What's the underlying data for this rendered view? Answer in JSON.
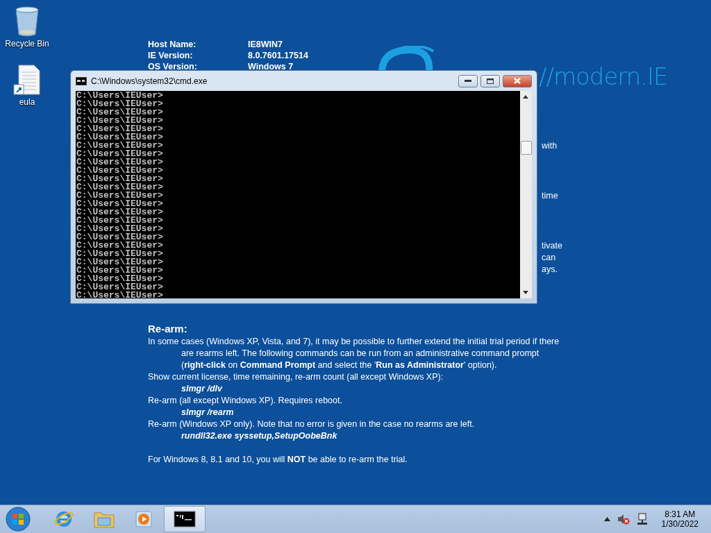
{
  "desktop_icons": [
    {
      "label": "Recycle Bin",
      "kind": "recycle"
    },
    {
      "label": "eula",
      "kind": "document"
    }
  ],
  "wallpaper": {
    "info": [
      {
        "label": "Host Name:",
        "value": "IE8WIN7"
      },
      {
        "label": "IE Version:",
        "value": "8.0.7601.17514"
      },
      {
        "label": "OS Version:",
        "value": "Windows 7"
      }
    ],
    "logo": "//modern.IE",
    "fragments": [
      "with",
      "time",
      "tivate",
      "can",
      "ays."
    ],
    "rearm": {
      "heading": "Re-arm:",
      "lines": [
        {
          "kind": "text",
          "text": "In some cases (Windows XP, Vista, and 7), it may be possible to further extend the initial trial period if there are rearms left. The following commands can be run from an administrative command prompt (**right-click** on **Command Prompt** and select the '**Run as Administrator**' option)."
        },
        {
          "kind": "text",
          "text": "Show current license, time remaining, re-arm count (all except Windows XP):"
        },
        {
          "kind": "command",
          "text": "slmgr /dlv"
        },
        {
          "kind": "text",
          "text": "Re-arm (all except Windows XP). Requires reboot."
        },
        {
          "kind": "command",
          "text": "slmgr /rearm"
        },
        {
          "kind": "text",
          "text": "Re-arm (Windows XP only). Note that no error is given in the case no rearms are left."
        },
        {
          "kind": "command",
          "text": "rundll32.exe syssetup,SetupOobeBnk"
        },
        {
          "kind": "note",
          "text": "For Windows 8, 8.1 and 10, you will **NOT** be able to re-arm the trial."
        }
      ]
    }
  },
  "cmd_window": {
    "title": "C:\\Windows\\system32\\cmd.exe",
    "lines": [
      "C:\\Users\\IEUser>",
      "C:\\Users\\IEUser>",
      "C:\\Users\\IEUser>",
      "C:\\Users\\IEUser>",
      "C:\\Users\\IEUser>",
      "C:\\Users\\IEUser>",
      "C:\\Users\\IEUser>",
      "C:\\Users\\IEUser>",
      "C:\\Users\\IEUser>",
      "C:\\Users\\IEUser>",
      "C:\\Users\\IEUser>",
      "C:\\Users\\IEUser>",
      "C:\\Users\\IEUser>",
      "C:\\Users\\IEUser>",
      "C:\\Users\\IEUser>",
      "C:\\Users\\IEUser>",
      "C:\\Users\\IEUser>",
      "C:\\Users\\IEUser>",
      "C:\\Users\\IEUser>",
      "C:\\Users\\IEUser>",
      "C:\\Users\\IEUser>",
      "C:\\Users\\IEUser>",
      "C:\\Users\\IEUser>",
      "C:\\Users\\IEUser>",
      "C:\\Users\\IEUser>"
    ]
  },
  "taskbar": {
    "items": [
      {
        "kind": "ie",
        "selected": false
      },
      {
        "kind": "explorer",
        "selected": false
      },
      {
        "kind": "media",
        "selected": false
      },
      {
        "kind": "cmd",
        "selected": true
      }
    ],
    "time": "8:31 AM",
    "date": "1/30/2022"
  }
}
